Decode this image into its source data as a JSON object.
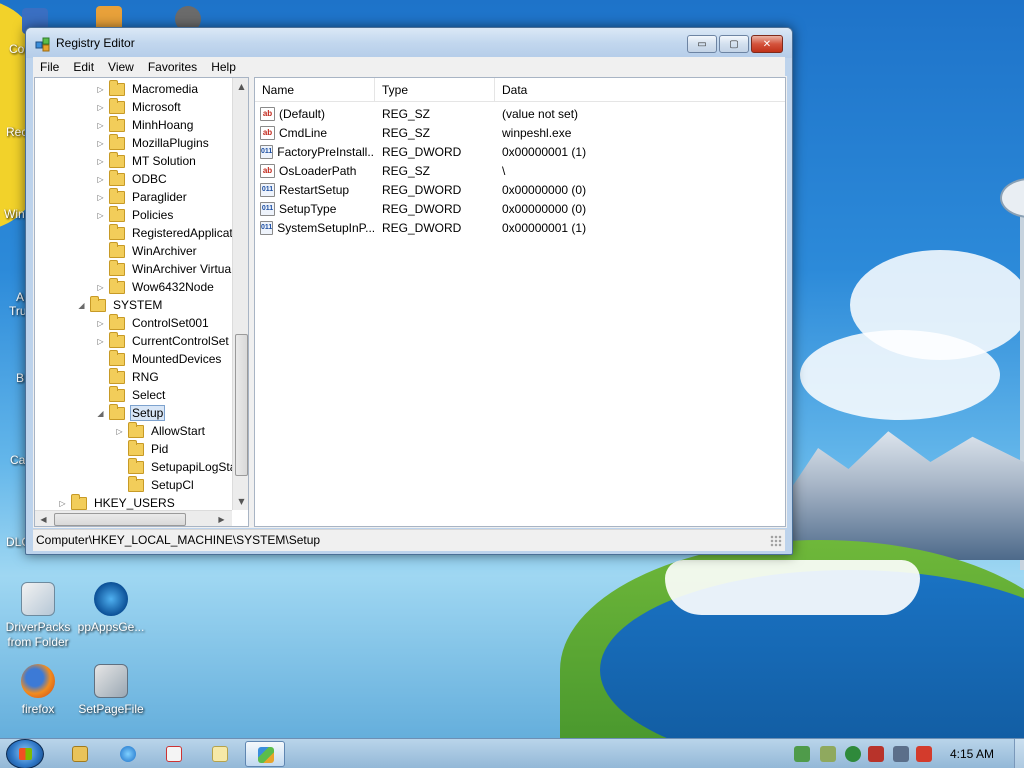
{
  "window": {
    "title": "Registry Editor",
    "menu": [
      "File",
      "Edit",
      "View",
      "Favorites",
      "Help"
    ],
    "caption_buttons": {
      "minimize": "▭",
      "maximize": "▢",
      "close": "✕"
    }
  },
  "tree": {
    "items": [
      {
        "label": "Macromedia",
        "expander": "▷"
      },
      {
        "label": "Microsoft",
        "expander": "▷"
      },
      {
        "label": "MinhHoang",
        "expander": "▷"
      },
      {
        "label": "MozillaPlugins",
        "expander": "▷"
      },
      {
        "label": "MT Solution",
        "expander": "▷"
      },
      {
        "label": "ODBC",
        "expander": "▷"
      },
      {
        "label": "Paraglider",
        "expander": "▷"
      },
      {
        "label": "Policies",
        "expander": "▷"
      },
      {
        "label": "RegisteredApplicat",
        "expander": ""
      },
      {
        "label": "WinArchiver",
        "expander": ""
      },
      {
        "label": "WinArchiver Virtua",
        "expander": ""
      },
      {
        "label": "Wow6432Node",
        "expander": "▷"
      },
      {
        "label": "SYSTEM",
        "expander": "◢"
      },
      {
        "label": "ControlSet001",
        "expander": "▷"
      },
      {
        "label": "CurrentControlSet",
        "expander": "▷"
      },
      {
        "label": "MountedDevices",
        "expander": ""
      },
      {
        "label": "RNG",
        "expander": ""
      },
      {
        "label": "Select",
        "expander": ""
      },
      {
        "label": "Setup",
        "expander": "◢"
      },
      {
        "label": "AllowStart",
        "expander": "▷"
      },
      {
        "label": "Pid",
        "expander": ""
      },
      {
        "label": "SetupapiLogSta",
        "expander": ""
      },
      {
        "label": "SetupCl",
        "expander": ""
      },
      {
        "label": "HKEY_USERS",
        "expander": "▷"
      }
    ],
    "scroll_arrows": {
      "up": "▲",
      "down": "▼",
      "left": "◀",
      "right": "▶"
    }
  },
  "list": {
    "columns": [
      "Name",
      "Type",
      "Data"
    ],
    "rows": [
      {
        "icon": "ab",
        "name": "(Default)",
        "type": "REG_SZ",
        "data": "(value not set)"
      },
      {
        "icon": "ab",
        "name": "CmdLine",
        "type": "REG_SZ",
        "data": "winpeshl.exe"
      },
      {
        "icon": "011",
        "name": "FactoryPreInstall...",
        "type": "REG_DWORD",
        "data": "0x00000001 (1)"
      },
      {
        "icon": "ab",
        "name": "OsLoaderPath",
        "type": "REG_SZ",
        "data": "\\"
      },
      {
        "icon": "011",
        "name": "RestartSetup",
        "type": "REG_DWORD",
        "data": "0x00000000 (0)"
      },
      {
        "icon": "011",
        "name": "SetupType",
        "type": "REG_DWORD",
        "data": "0x00000000 (0)"
      },
      {
        "icon": "011",
        "name": "SystemSetupInP...",
        "type": "REG_DWORD",
        "data": "0x00000001 (1)"
      }
    ]
  },
  "status": {
    "path": "Computer\\HKEY_LOCAL_MACHINE\\SYSTEM\\Setup"
  },
  "desktop": {
    "icons": [
      {
        "label": "DriverPacks from Folder",
        "icon": "driverpacks-icon"
      },
      {
        "label": "ppAppsGe...",
        "icon": "ppapps-icon"
      },
      {
        "label": "firefox",
        "icon": "firefox-icon"
      },
      {
        "label": "SetPageFile",
        "icon": "setpagefile-icon"
      }
    ],
    "partial_labels": [
      "Co",
      "Rec",
      "Win",
      "A",
      "Tru",
      "B",
      "Ca",
      "DLC"
    ]
  },
  "taskbar": {
    "clock": "4:15 AM",
    "pinned": [
      "explorer-icon",
      "internet-explorer-icon",
      "paint-icon",
      "notepad-icon",
      "regedit-icon"
    ]
  },
  "colors": {
    "title_bar": "#c2d7ee",
    "selection": "#d8e6f7",
    "close_button": "#c0321a",
    "folder": "#f2cd5a"
  }
}
